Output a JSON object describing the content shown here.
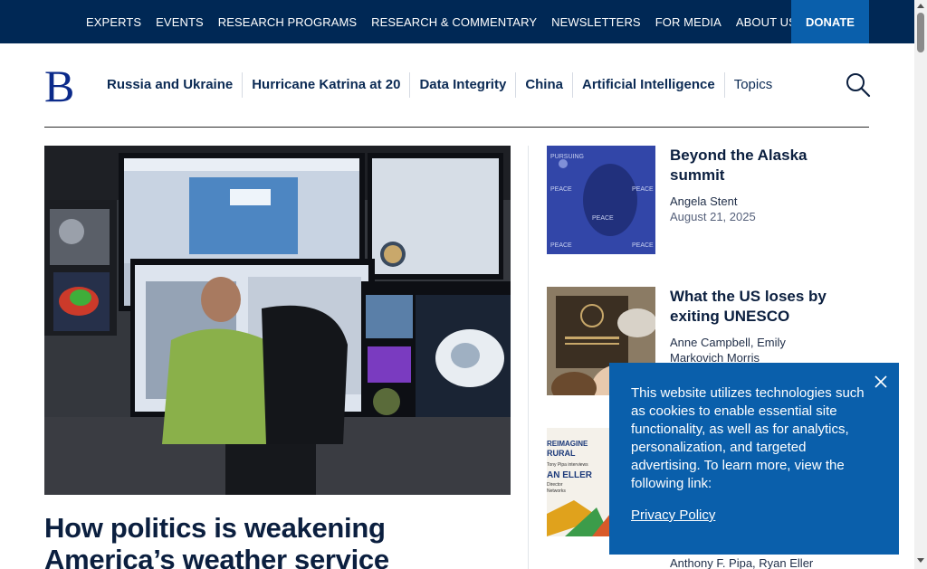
{
  "topbar": {
    "items": [
      "EXPERTS",
      "EVENTS",
      "RESEARCH PROGRAMS",
      "RESEARCH & COMMENTARY",
      "NEWSLETTERS",
      "FOR MEDIA",
      "ABOUT US"
    ],
    "donate_label": "DONATE"
  },
  "logo": {
    "letter": "B"
  },
  "mainnav": {
    "items": [
      "Russia and Ukraine",
      "Hurricane Katrina at 20",
      "Data Integrity",
      "China",
      "Artificial Intelligence",
      "Topics"
    ]
  },
  "hero": {
    "title": "How politics is weakening America’s weather service"
  },
  "stories": [
    {
      "title": "Beyond the Alaska summit",
      "author": "Angela Stent",
      "date": "August 21, 2025",
      "thumb_text": [
        "PURSUING",
        "PEACE"
      ]
    },
    {
      "title": "What the US loses by exiting UNESCO",
      "author": "Anne Campbell, Emily Markovich Morris",
      "date": ""
    },
    {
      "title": "",
      "author": "Anthony F. Pipa, Ryan Eller",
      "date": "",
      "thumb_text": [
        "REIMAGINE",
        "RURAL",
        "Tony Pipa interviews",
        "AN ELLER",
        "Director",
        "Networks"
      ]
    }
  ],
  "cookie": {
    "text": "This website utilizes technologies such as cookies to enable essential site functionality, as well as for analytics, personalization, and targeted advertising. To learn more, view the following link:",
    "link": "Privacy Policy"
  },
  "colors": {
    "topbar_bg": "#002855",
    "donate_bg": "#0a5fab",
    "cookie_bg": "#0a5fab",
    "title_text": "#0b1f3f"
  }
}
